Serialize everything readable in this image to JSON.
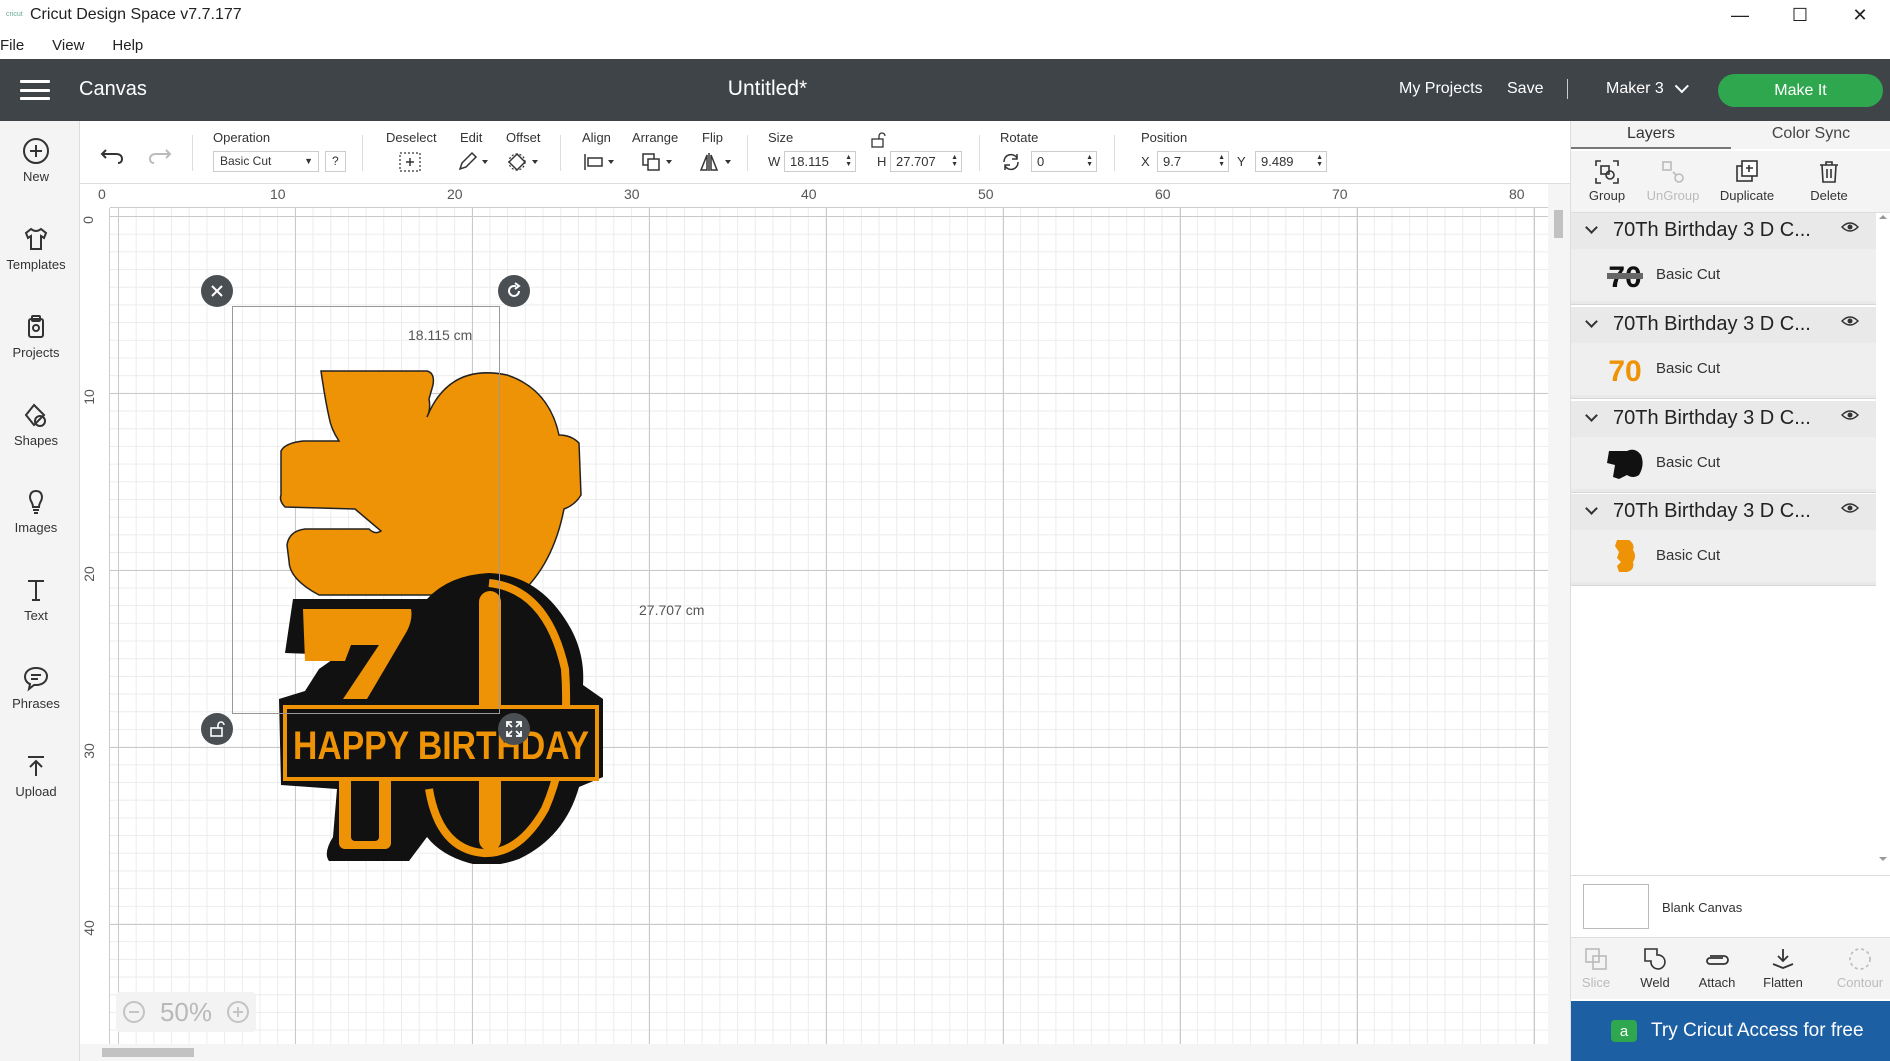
{
  "window": {
    "icon_text": "cricut",
    "title": "Cricut Design Space  v7.7.177",
    "minimize": "—",
    "maximize": "☐",
    "close": "✕"
  },
  "menu": [
    "File",
    "View",
    "Help"
  ],
  "header": {
    "section": "Canvas",
    "document_title": "Untitled*",
    "my_projects": "My Projects",
    "save": "Save",
    "separator": "|",
    "machine": "Maker 3",
    "make_it": "Make It",
    "accent_color": "#2fa74f"
  },
  "left_nav": [
    {
      "label": "New",
      "icon": "plus-circle-icon"
    },
    {
      "label": "Templates",
      "icon": "shirt-icon"
    },
    {
      "label": "Projects",
      "icon": "projects-icon"
    },
    {
      "label": "Shapes",
      "icon": "shapes-icon"
    },
    {
      "label": "Images",
      "icon": "lightbulb-icon"
    },
    {
      "label": "Text",
      "icon": "text-icon"
    },
    {
      "label": "Phrases",
      "icon": "speech-bubble-icon"
    },
    {
      "label": "Upload",
      "icon": "upload-icon"
    }
  ],
  "toolbar": {
    "operation_label": "Operation",
    "operation_value": "Basic Cut",
    "help": "?",
    "deselect": "Deselect",
    "edit": "Edit",
    "offset": "Offset",
    "align": "Align",
    "arrange": "Arrange",
    "flip": "Flip",
    "size_label": "Size",
    "w_label": "W",
    "w_value": "18.115",
    "h_label": "H",
    "h_value": "27.707",
    "rotate_label": "Rotate",
    "rotate_value": "0",
    "position_label": "Position",
    "x_label": "X",
    "x_value": "9.7",
    "y_label": "Y",
    "y_value": "9.489"
  },
  "canvas": {
    "ruler_top": [
      "0",
      "10",
      "20",
      "30",
      "40",
      "50",
      "60",
      "70",
      "80"
    ],
    "ruler_left": [
      "0",
      "10",
      "20",
      "30",
      "40"
    ],
    "width_label": "18.115 cm",
    "height_label": "27.707 cm",
    "zoom": "50%",
    "design_text": "HAPPY BIRTHDAY",
    "design_number": "70",
    "orange": "#ee9306",
    "black": "#111111"
  },
  "right_panel": {
    "tabs": [
      "Layers",
      "Color Sync"
    ],
    "tools": [
      {
        "label": "Group",
        "enabled": true
      },
      {
        "label": "UnGroup",
        "enabled": false
      },
      {
        "label": "Duplicate",
        "enabled": true
      },
      {
        "label": "Delete",
        "enabled": true
      }
    ],
    "layers": [
      {
        "name": "70Th Birthday 3 D C...",
        "operation": "Basic Cut"
      },
      {
        "name": "70Th Birthday 3 D C...",
        "operation": "Basic Cut"
      },
      {
        "name": "70Th Birthday 3 D C...",
        "operation": "Basic Cut"
      },
      {
        "name": "70Th Birthday 3 D C...",
        "operation": "Basic Cut"
      }
    ],
    "blank_canvas": "Blank Canvas",
    "bottom_tools": [
      {
        "label": "Slice",
        "enabled": false
      },
      {
        "label": "Weld",
        "enabled": true
      },
      {
        "label": "Attach",
        "enabled": true
      },
      {
        "label": "Flatten",
        "enabled": true
      },
      {
        "label": "Contour",
        "enabled": false
      }
    ],
    "access_banner": "Try Cricut Access for free",
    "access_icon": "a"
  }
}
